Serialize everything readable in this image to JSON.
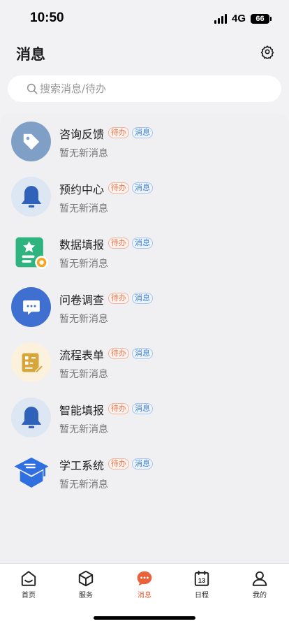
{
  "status_bar": {
    "time": "10:50",
    "network": "4G",
    "battery": "66"
  },
  "header": {
    "title": "消息"
  },
  "search": {
    "placeholder": "搜索消息/待办"
  },
  "messages": [
    {
      "title": "咨询反馈",
      "tag_todo": "待办",
      "tag_msg": "消息",
      "subtitle": "暂无新消息",
      "icon": "tag-icon"
    },
    {
      "title": "预约中心",
      "tag_todo": "待办",
      "tag_msg": "消息",
      "subtitle": "暂无新消息",
      "icon": "bell-icon"
    },
    {
      "title": "数据填报",
      "tag_todo": "待办",
      "tag_msg": "消息",
      "subtitle": "暂无新消息",
      "icon": "form-star-icon"
    },
    {
      "title": "问卷调查",
      "tag_todo": "待办",
      "tag_msg": "消息",
      "subtitle": "暂无新消息",
      "icon": "chat-icon"
    },
    {
      "title": "流程表单",
      "tag_todo": "待办",
      "tag_msg": "消息",
      "subtitle": "暂无新消息",
      "icon": "flow-form-icon"
    },
    {
      "title": "智能填报",
      "tag_todo": "待办",
      "tag_msg": "消息",
      "subtitle": "暂无新消息",
      "icon": "bell-icon"
    },
    {
      "title": "学工系统",
      "tag_todo": "待办",
      "tag_msg": "消息",
      "subtitle": "暂无新消息",
      "icon": "graduation-cap-icon"
    }
  ],
  "tabs": [
    {
      "label": "首页",
      "icon": "home-icon",
      "active": false
    },
    {
      "label": "服务",
      "icon": "cube-icon",
      "active": false
    },
    {
      "label": "消息",
      "icon": "message-icon",
      "active": true
    },
    {
      "label": "日程",
      "icon": "calendar-icon",
      "active": false,
      "badge_text": "13"
    },
    {
      "label": "我的",
      "icon": "profile-icon",
      "active": false
    }
  ],
  "colors": {
    "accent": "#e8623a",
    "tag_todo": "#e57a55",
    "tag_msg": "#3d7fd9"
  }
}
